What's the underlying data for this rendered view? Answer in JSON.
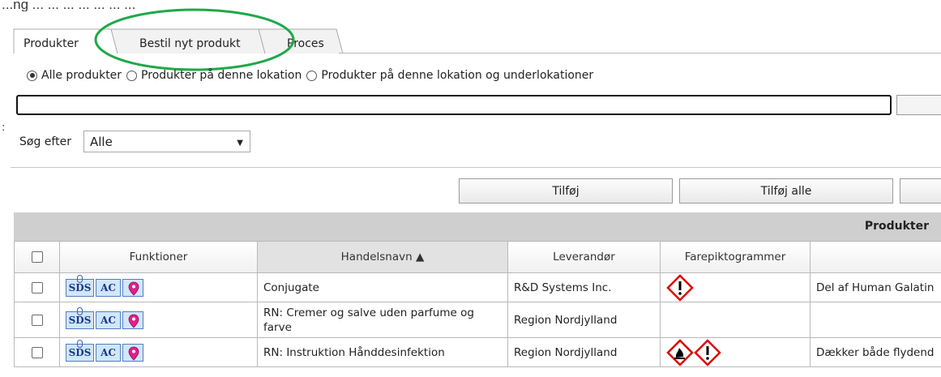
{
  "caption": "...ng ... ... ... ... ... ... ...",
  "tabs": [
    {
      "label": "Produkter"
    },
    {
      "label": "Bestil nyt produkt"
    },
    {
      "label": "Proces"
    }
  ],
  "scope_options": [
    {
      "label": "Alle produkter",
      "checked": true
    },
    {
      "label": "Produkter på denne lokation",
      "checked": false
    },
    {
      "label": "Produkter på denne lokation og underlokationer",
      "checked": false
    }
  ],
  "search": {
    "value": ""
  },
  "filter": {
    "label": "Søg efter",
    "selected": "Alle"
  },
  "actions": {
    "add": "Tilføj",
    "add_all": "Tilføj alle"
  },
  "grid": {
    "title": "Produkter",
    "columns": [
      "Funktioner",
      "Handelsnavn ▲",
      "Leverandør",
      "Farepiktogrammer",
      ""
    ],
    "rows": [
      {
        "name": "Conjugate",
        "supplier": "R&D Systems Inc.",
        "pictograms": [
          "exclamation-mark"
        ],
        "note": "Del af Human Galatin"
      },
      {
        "name": "RN: Cremer og salve uden parfume og farve",
        "supplier": "Region Nordjylland",
        "pictograms": [],
        "note": ""
      },
      {
        "name": "RN: Instruktion Hånddesinfektion",
        "supplier": "Region Nordjylland",
        "pictograms": [
          "flame",
          "exclamation-mark"
        ],
        "note": "Dækker både flydend"
      }
    ]
  },
  "function_icons": {
    "sds": "SDS",
    "ac": "AC",
    "location": "location-pin-icon"
  },
  "colors": {
    "highlight": "#1fa84a",
    "grid_header": "#cfcfcf",
    "icon_bg": "#d2e6fa",
    "ghs_red": "#e00000",
    "pin": "#e0208a"
  }
}
